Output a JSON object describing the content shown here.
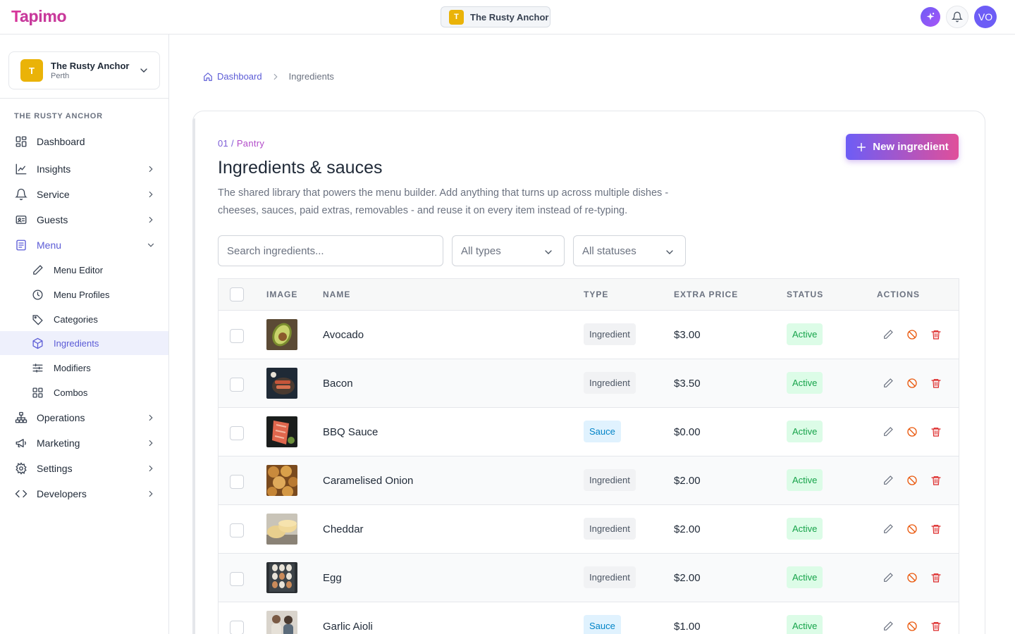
{
  "topbar": {
    "logo": {
      "first": "T",
      "rest": "apimo"
    },
    "venue": {
      "initial": "T",
      "name": "The Rusty Anchor"
    },
    "user_initials": "VO"
  },
  "sidebar": {
    "venue": {
      "initial": "T",
      "name": "The Rusty Anchor",
      "city": "Perth"
    },
    "heading": "THE RUSTY ANCHOR",
    "items": [
      {
        "label": "Dashboard",
        "icon": "dashboard-icon"
      },
      {
        "label": "Insights",
        "icon": "chart-icon"
      },
      {
        "label": "Service",
        "icon": "bell-icon"
      },
      {
        "label": "Guests",
        "icon": "id-card-icon"
      },
      {
        "label": "Menu",
        "icon": "menu-book-icon"
      },
      {
        "label": "Operations",
        "icon": "org-chart-icon"
      },
      {
        "label": "Marketing",
        "icon": "megaphone-icon"
      },
      {
        "label": "Settings",
        "icon": "gear-icon"
      },
      {
        "label": "Developers",
        "icon": "code-icon"
      }
    ],
    "menu_subitems": [
      {
        "label": "Menu Editor",
        "icon": "pencil-icon"
      },
      {
        "label": "Menu Profiles",
        "icon": "clock-icon"
      },
      {
        "label": "Categories",
        "icon": "tag-icon"
      },
      {
        "label": "Ingredients",
        "icon": "cube-icon"
      },
      {
        "label": "Modifiers",
        "icon": "sliders-icon"
      },
      {
        "label": "Combos",
        "icon": "grid-icon"
      }
    ]
  },
  "breadcrumb": {
    "home": "Dashboard",
    "current": "Ingredients"
  },
  "page": {
    "eyebrow_num": "01 /",
    "eyebrow_section": "Pantry",
    "title": "Ingredients & sauces",
    "description": "The shared library that powers the menu builder. Add anything that turns up across multiple dishes - cheeses, sauces, paid extras, removables - and reuse it on every item instead of re-typing.",
    "new_button": "New ingredient"
  },
  "filters": {
    "search_placeholder": "Search ingredients...",
    "type_selected": "All types",
    "status_selected": "All statuses"
  },
  "table": {
    "columns": {
      "image": "IMAGE",
      "name": "NAME",
      "type": "TYPE",
      "extra_price": "EXTRA PRICE",
      "status": "STATUS",
      "actions": "ACTIONS"
    },
    "rows": [
      {
        "name": "Avocado",
        "type": "Ingredient",
        "price": "$3.00",
        "status": "Active"
      },
      {
        "name": "Bacon",
        "type": "Ingredient",
        "price": "$3.50",
        "status": "Active"
      },
      {
        "name": "BBQ Sauce",
        "type": "Sauce",
        "price": "$0.00",
        "status": "Active"
      },
      {
        "name": "Caramelised Onion",
        "type": "Ingredient",
        "price": "$2.00",
        "status": "Active"
      },
      {
        "name": "Cheddar",
        "type": "Ingredient",
        "price": "$2.00",
        "status": "Active"
      },
      {
        "name": "Egg",
        "type": "Ingredient",
        "price": "$2.00",
        "status": "Active"
      },
      {
        "name": "Garlic Aioli",
        "type": "Sauce",
        "price": "$1.00",
        "status": "Active"
      }
    ]
  },
  "colors": {
    "brand_pink": "#d6359a",
    "accent_purple": "#5b5bd6",
    "venue_yellow": "#eab308",
    "active_green": "#16a34a",
    "sauce_blue": "#0284c7",
    "delete_red": "#dc2626",
    "disable_orange": "#ea580c"
  }
}
